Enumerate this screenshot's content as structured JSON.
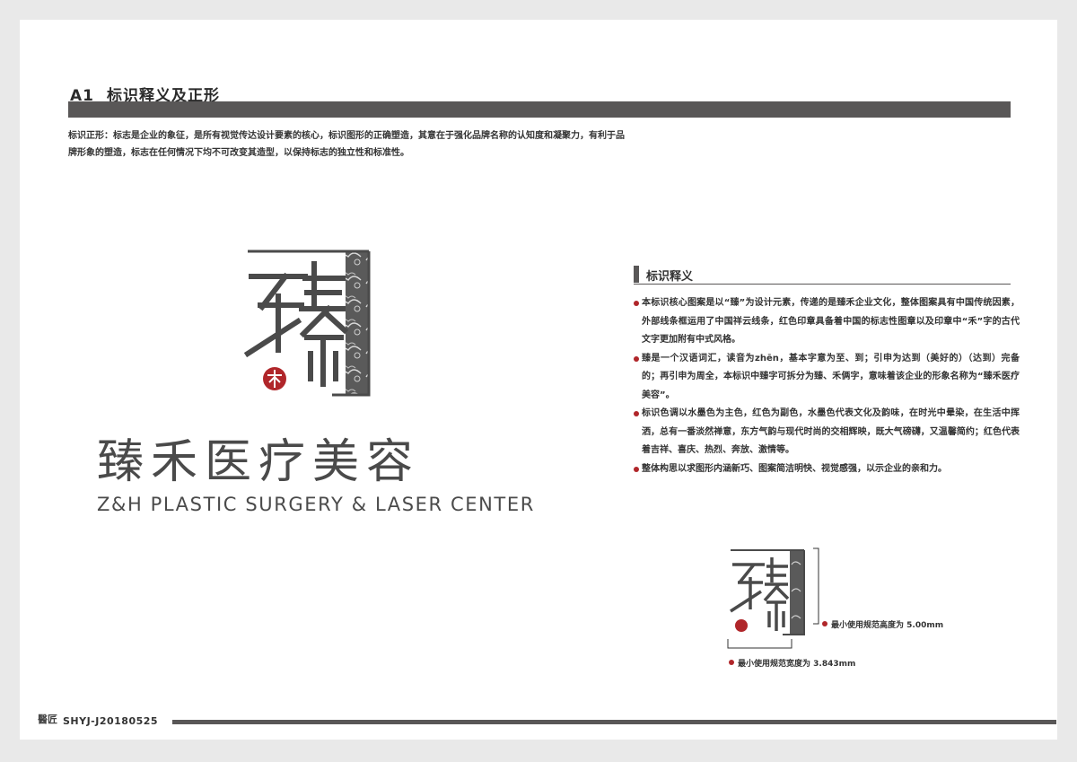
{
  "section": {
    "code": "A1",
    "title": "标识释义及正形"
  },
  "intro": "标识正形：标志是企业的象征，是所有视觉传达设计要素的核心，标识图形的正确塑造，其意在于强化品牌名称的认知度和凝聚力，有利于品牌形象的塑造，标志在任何情况下均不可改变其造型，以保持标志的独立性和标准性。",
  "logo": {
    "glyph": "臻",
    "seal_char": "禾",
    "name_cn": "臻禾医疗美容",
    "name_en": "Z&H PLASTIC SURGERY & LASER CENTER",
    "colors": {
      "ink": "#4a4a4a",
      "seal": "#b0262a",
      "cloud": "#555555"
    }
  },
  "panel": {
    "title": "标识释义",
    "notes": [
      "本标识核心图案是以“臻”为设计元素，传递的是臻禾企业文化，整体图案具有中国传统因素，外部线条框运用了中国祥云线条，红色印章具备着中国的标志性图章以及印章中“禾”字的古代文字更加附有中式风格。",
      "臻是一个汉语词汇，读音为zhēn，基本字意为至、到；引申为达到（美好的）（达到）完备的；再引申为周全，本标识中臻字可拆分为臻、禾俩字，意味着该企业的形象名称为“臻禾医疗美容”。",
      "标识色调以水墨色为主色，红色为副色，水墨色代表文化及韵味，在时光中晕染，在生活中挥洒，总有一番淡然禅意，东方气韵与现代时尚的交相辉映，既大气磅礴，又温馨简约；红色代表着吉祥、喜庆、热烈、奔放、激情等。",
      "整体构思以求图形内涵新巧、图案简洁明快、视觉感强，以示企业的亲和力。"
    ]
  },
  "min_size": {
    "height_label": "最小使用规范高度为 5.00mm",
    "width_label": "最小使用规范宽度为 3.843mm"
  },
  "footer": {
    "mark": "醫匠",
    "code": "SHYJ-J20180525"
  }
}
